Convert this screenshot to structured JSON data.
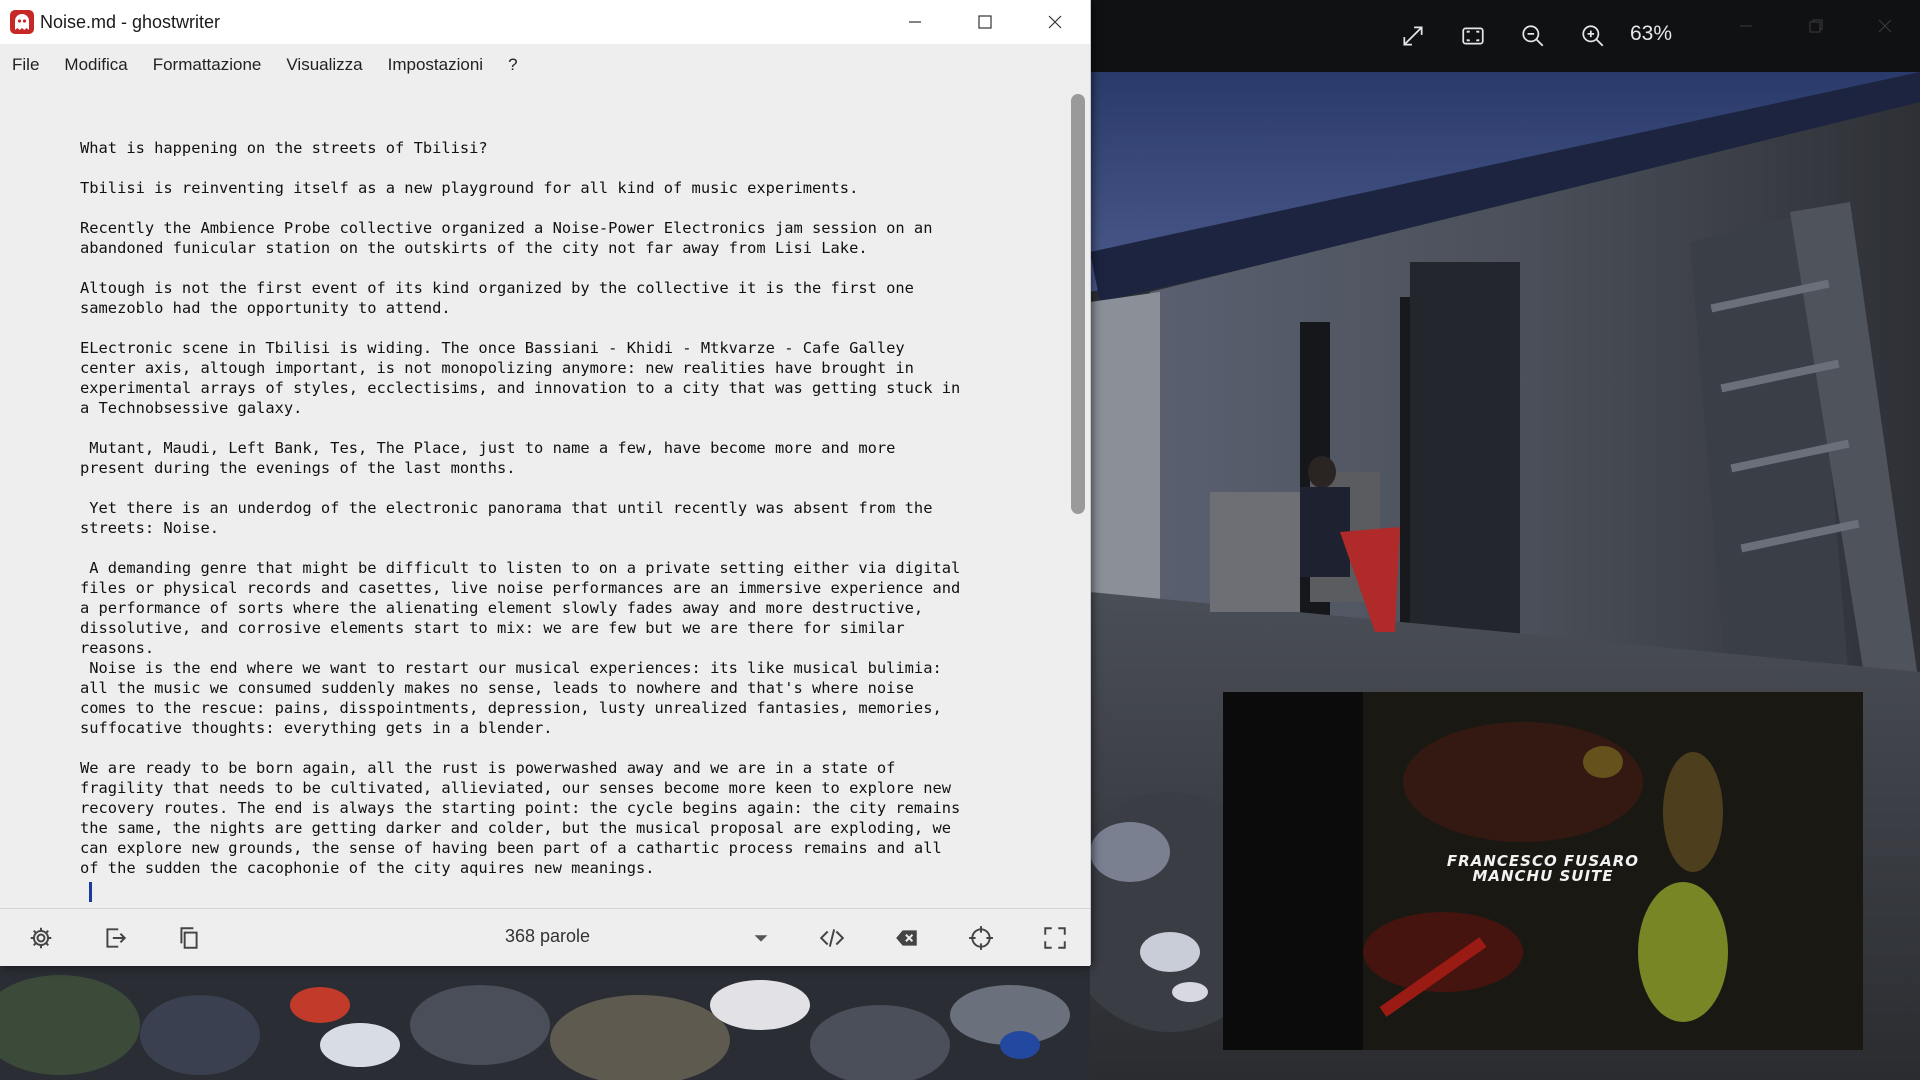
{
  "window": {
    "title": "Noise.md - ghostwriter"
  },
  "menu": [
    "File",
    "Modifica",
    "Formattazione",
    "Visualizza",
    "Impostazioni",
    "?"
  ],
  "editor": {
    "content": "What is happening on the streets of Tbilisi?\n\nTbilisi is reinventing itself as a new playground for all kind of music experiments.\n\nRecently the Ambience Probe collective organized a Noise-Power Electronics jam session on an\nabandoned funicular station on the outskirts of the city not far away from Lisi Lake.\n\nAltough is not the first event of its kind organized by the collective it is the first one\nsamezoblo had the opportunity to attend.\n\nELectronic scene in Tbilisi is widing. The once Bassiani - Khidi - Mtkvarze - Cafe Galley\ncenter axis, altough important, is not monopolizing anymore: new realities have brought in\nexperimental arrays of styles, ecclectisims, and innovation to a city that was getting stuck in\na Technobsessive galaxy.\n\n Mutant, Maudi, Left Bank, Tes, The Place, just to name a few, have become more and more\npresent during the evenings of the last months.\n\n Yet there is an underdog of the electronic panorama that until recently was absent from the\nstreets: Noise.\n\n A demanding genre that might be difficult to listen to on a private setting either via digital\nfiles or physical records and casettes, live noise performances are an immersive experience and\na performance of sorts where the alienating element slowly fades away and more destructive,\ndissolutive, and corrosive elements start to mix: we are few but we are there for similar\nreasons.\n Noise is the end where we want to restart our musical experiences: its like musical bulimia:\nall the music we consumed suddenly makes no sense, leads to nowhere and that's where noise\ncomes to the rescue: pains, disspointments, depression, lusty unrealized fantasies, memories,\nsuffocative thoughts: everything gets in a blender.\n\nWe are ready to be born again, all the rust is powerwashed away and we are in a state of\nfragility that needs to be cultivated, allieviated, our senses become more keen to explore new\nrecovery routes. The end is always the starting point: the cycle begins again: the city remains\nthe same, the nights are getting darker and colder, but the musical proposal are exploding, we\ncan explore new grounds, the sense of having been part of a cathartic process remains and all\nof the sudden the cacophonie of the city aquires new meanings."
  },
  "statusbar": {
    "word_count": "368 parole"
  },
  "viewer": {
    "zoom": "63%",
    "album_line1": "FRANCESCO FUSARO",
    "album_line2": "MANCHU SUITE"
  },
  "icons": {
    "app": "ghost-icon",
    "settings": "gear-icon",
    "export": "export-icon",
    "copy": "copy-icon",
    "dropdown": "chevron-down-icon",
    "html_preview": "code-icon",
    "backspace": "backspace-icon",
    "focus": "crosshair-icon",
    "fullscreen": "fullscreen-icon"
  },
  "colors": {
    "editor_bg": "#eeeeee",
    "caret": "#1a3a9e",
    "viewer_toolbar": "#101113"
  }
}
